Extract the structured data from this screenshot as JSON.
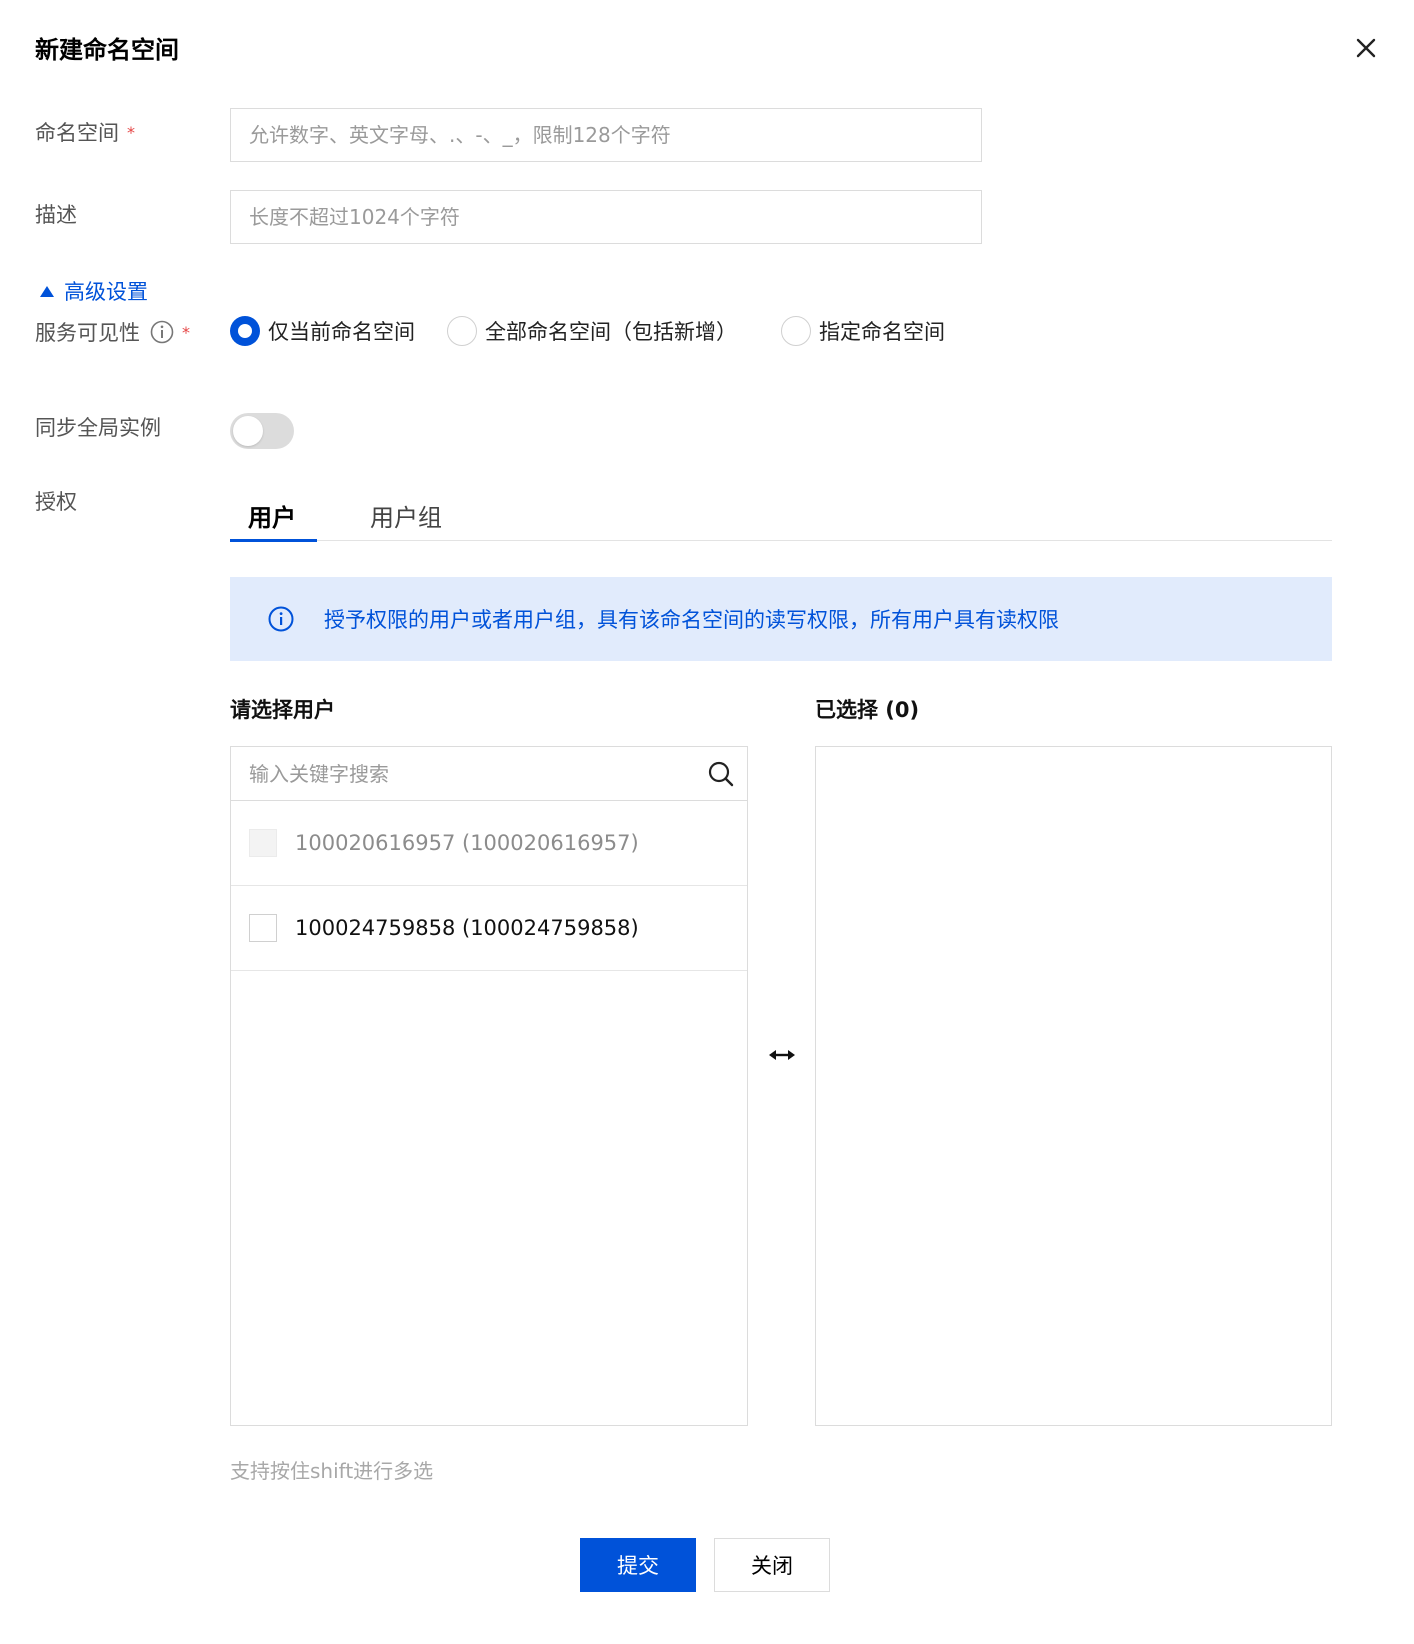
{
  "dialog": {
    "title": "新建命名空间"
  },
  "form": {
    "namespace": {
      "label": "命名空间",
      "required_mark": "*",
      "value": "",
      "placeholder": "允许数字、英文字母、.、-、_，限制128个字符"
    },
    "description": {
      "label": "描述",
      "value": "",
      "placeholder": "长度不超过1024个字符"
    },
    "advanced_toggle": "高级设置",
    "visibility": {
      "label": "服务可见性",
      "required_mark": "*",
      "options": [
        {
          "label": "仅当前命名空间",
          "checked": true
        },
        {
          "label": "全部命名空间（包括新增）",
          "checked": false
        },
        {
          "label": "指定命名空间",
          "checked": false
        }
      ]
    },
    "sync_global": {
      "label": "同步全局实例",
      "enabled": false
    },
    "auth": {
      "label": "授权",
      "tabs": [
        {
          "label": "用户",
          "active": true
        },
        {
          "label": "用户组",
          "active": false
        }
      ],
      "alert_text": "授予权限的用户或者用户组，具有该命名空间的读写权限，所有用户具有读权限",
      "source": {
        "title": "请选择用户",
        "search_placeholder": "输入关键字搜索",
        "search_value": "",
        "items": [
          {
            "label": "100020616957 (100020616957)",
            "disabled": true,
            "checked": false
          },
          {
            "label": "100024759858 (100024759858)",
            "disabled": false,
            "checked": false
          }
        ]
      },
      "target": {
        "title": "已选择 (0)"
      },
      "hint": "支持按住shift进行多选"
    }
  },
  "footer": {
    "submit_label": "提交",
    "close_label": "关闭"
  },
  "colors": {
    "primary": "#0052d9",
    "required": "#e54545",
    "alert_bg": "#e1ebfc"
  },
  "icons": [
    "close-icon",
    "triangle-up-icon",
    "info-icon",
    "search-icon",
    "transfer-arrows-icon"
  ]
}
